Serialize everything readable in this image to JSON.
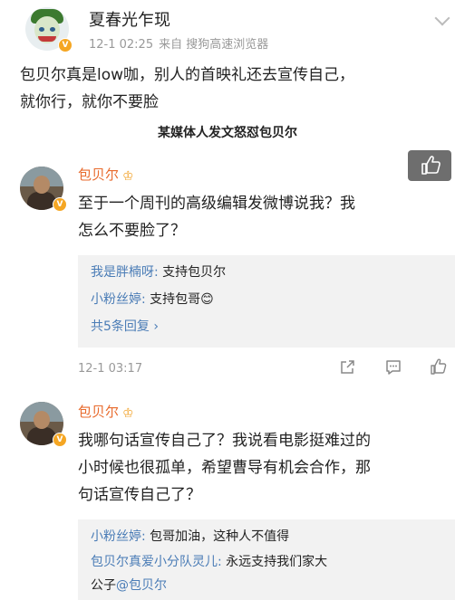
{
  "post": {
    "username": "夏春光乍现",
    "time": "12-1 02:25",
    "source": "来自 搜狗高速浏览器",
    "text_line1": "包贝尔真是low咖，别人的首映礼还去宣传自己，",
    "text_line2": "就你行，就你不要脸",
    "caption": "某媒体人发文怒怼包贝尔",
    "verified_badge": "V"
  },
  "comments": [
    {
      "author": "包贝尔",
      "text_line1": "至于一个周刊的高级编辑发微博说我？我",
      "text_line2": "怎么不要脸了？",
      "replies": [
        {
          "name": "我是胖楠呀:",
          "text": " 支持包贝尔"
        },
        {
          "name": "小粉丝婷:",
          "text": " 支持包哥😊"
        }
      ],
      "more_replies": "共5条回复 ›",
      "time": "12-1 03:17"
    },
    {
      "author": "包贝尔",
      "text_line1": "我哪句话宣传自己了？我说看电影挺难过的",
      "text_line2": "小时候也很孤单，希望曹导有机会合作，那",
      "text_line3": "句话宣传自己了？",
      "replies": [
        {
          "name": "小粉丝婷:",
          "text": " 包哥加油，这种人不值得"
        },
        {
          "name": "包贝尔真爱小分队灵儿:",
          "text": " 永远支持我们家大"
        }
      ],
      "reply_cont_text": "公子",
      "reply_cont_mention": "@包贝尔"
    }
  ],
  "icons": [
    "chevron-down-icon",
    "verified-icon",
    "crown-icon",
    "thumbs-up-icon",
    "share-icon",
    "comment-icon"
  ],
  "colors": {
    "author_orange": "#e86a2c",
    "link_blue": "#4a7cb6",
    "meta_gray": "#999999",
    "reply_bg": "#f2f2f2"
  }
}
